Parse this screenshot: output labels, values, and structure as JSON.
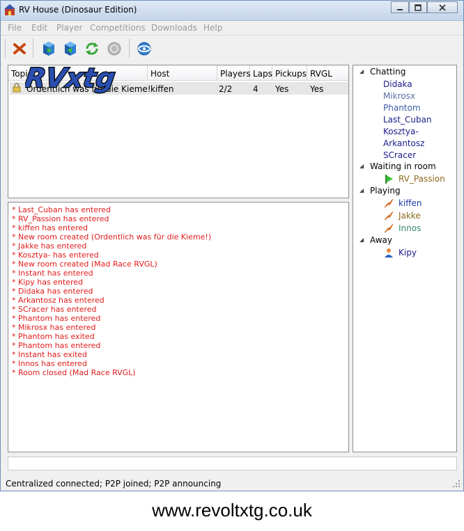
{
  "window": {
    "title": "RV House (Dinosaur Edition)"
  },
  "menu": [
    "File",
    "Edit",
    "Player",
    "Competitions",
    "Downloads",
    "Help"
  ],
  "toolbar": {
    "icons": [
      "disconnect-icon",
      "host-room-icon",
      "join-room-icon",
      "refresh-icon",
      "disabled-icon",
      "connection-icon"
    ]
  },
  "rooms": {
    "columns": [
      "Topic",
      "Host",
      "Players",
      "Laps",
      "Pickups",
      "RVGL"
    ],
    "rows": [
      {
        "topic": "Ordentlich was für die Kieme!",
        "host": "kiffen",
        "players": "2/2",
        "laps": "4",
        "pickups": "Yes",
        "rvgl": "Yes"
      }
    ]
  },
  "log": [
    "* Last_Cuban has entered",
    "* RV_Passion has entered",
    "* kiffen has entered",
    "* New room created (Ordentlich was für die Kieme!)",
    "* Jakke has entered",
    "* Kosztya- has entered",
    "* New room created (Mad Race RVGL)",
    "* Instant has entered",
    "* Kipy has entered",
    "* Didaka has entered",
    "* Arkantosz has entered",
    "* SCracer has entered",
    "* Phantom has entered",
    "* Mikrosx has entered",
    "* Phantom has exited",
    "* Phantom has entered",
    "* Instant has exited",
    "* Innos has entered",
    "* Room closed (Mad Race RVGL)"
  ],
  "users": {
    "chatting_label": "Chatting",
    "chatting": [
      {
        "name": "Didaka",
        "color": "#1a1a8c"
      },
      {
        "name": "Mikrosx",
        "color": "#5a6ea8"
      },
      {
        "name": "Phantom",
        "color": "#3a5aa8"
      },
      {
        "name": "Last_Cuban",
        "color": "#1a1a8c"
      },
      {
        "name": "Kosztya-",
        "color": "#1a1a8c"
      },
      {
        "name": "Arkantosz",
        "color": "#1a1a8c"
      },
      {
        "name": "SCracer",
        "color": "#1a1a8c"
      }
    ],
    "waiting_label": "Waiting in room",
    "waiting": [
      {
        "name": "RV_Passion",
        "color": "#8b6a1e"
      }
    ],
    "playing_label": "Playing",
    "playing": [
      {
        "name": "kiffen",
        "color": "#1a3ca8"
      },
      {
        "name": "Jakke",
        "color": "#8b6a1e"
      },
      {
        "name": "Innos",
        "color": "#3a8a6a"
      }
    ],
    "away_label": "Away",
    "away": [
      {
        "name": "Kipy",
        "color": "#1a1a8c"
      }
    ]
  },
  "status": "Centralized connected; P2P joined; P2P announcing",
  "watermark": "RVxtg",
  "footer": "www.revoltxtg.co.uk",
  "colors": {
    "log_text": "#e21b1b",
    "menu_disabled": "#9a9a9a"
  }
}
